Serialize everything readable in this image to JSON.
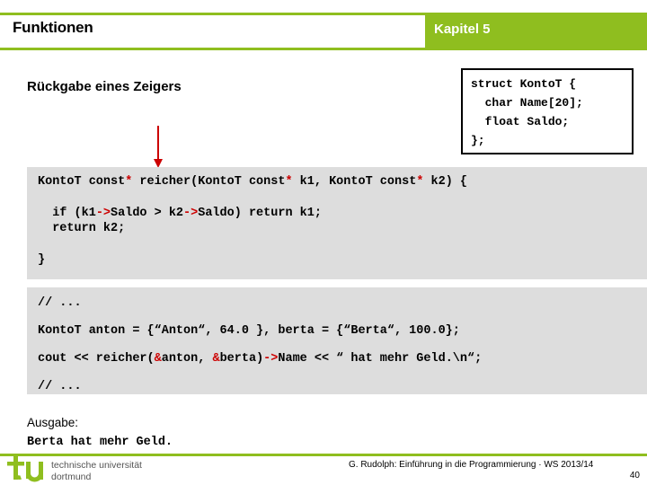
{
  "header": {
    "title": "Funktionen",
    "chapter": "Kapitel 5",
    "accent_color": "#8FBE1F"
  },
  "subtitle": "Rückgabe eines Zeigers",
  "struct_box": {
    "lines": [
      "struct KontoT {",
      "  char Name[20];",
      "  float Saldo;",
      "};"
    ]
  },
  "code_function": {
    "line1_a": "KontoT const",
    "line1_b": "*",
    "line1_c": " reicher(KontoT const",
    "line1_d": "*",
    "line1_e": " k1, KontoT const",
    "line1_f": "*",
    "line1_g": " k2) {",
    "line2_a": "  if (k1",
    "line2_b": "->",
    "line2_c": "Saldo > k2",
    "line2_d": "->",
    "line2_e": "Saldo) return k1;",
    "line3": "  return k2;",
    "line4": "}"
  },
  "code_usage": {
    "line1": "// ...",
    "line2": "KontoT anton = {“Anton“, 64.0 }, berta = {“Berta“, 100.0};",
    "line3_a": "cout << reicher(",
    "line3_b": "&",
    "line3_c": "anton, ",
    "line3_d": "&",
    "line3_e": "berta)",
    "line3_f": "->",
    "line3_g": "Name << “ hat mehr Geld.\\n“;",
    "line4": "// ..."
  },
  "output": {
    "label": "Ausgabe:",
    "text": "Berta hat mehr Geld."
  },
  "footer": {
    "logo_mark": "tu",
    "logo_line1": "technische universität",
    "logo_line2": "dortmund",
    "credit": "G. Rudolph: Einführung in die Programmierung · WS 2013/14",
    "page_number": "40"
  }
}
